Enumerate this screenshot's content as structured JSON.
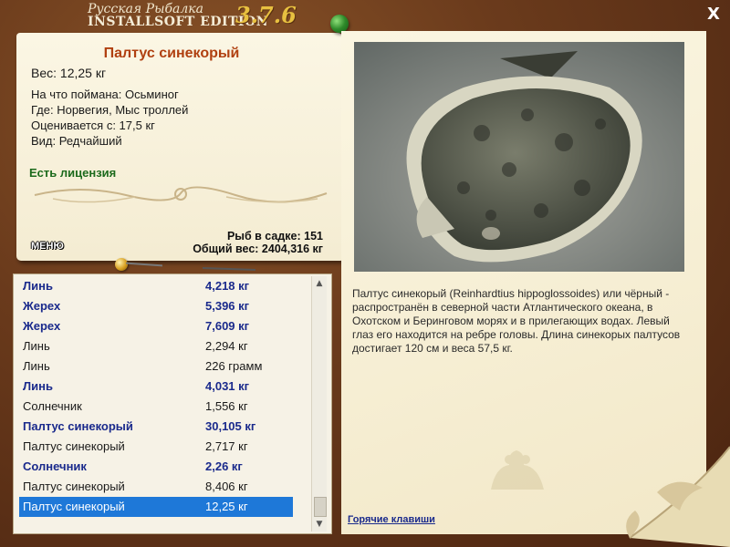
{
  "window": {
    "title_top": "Русская Рыбалка",
    "title_main": "INSTALLSOFT EDITION",
    "version": "3.7.6",
    "close_label": "X"
  },
  "fish": {
    "name": "Палтус синекорый",
    "weight": "Вес: 12,25 кг",
    "bait": "На что поймана: Осьминог",
    "place": "Где: Норвегия, Мыс троллей",
    "value": "Оценивается с: 17,5 кг",
    "rarity": "Вид: Редчайший",
    "license": "Есть лицензия"
  },
  "stats": {
    "count": "Рыб в садке: 151",
    "total": "Общий вес: 2404,316 кг"
  },
  "menu_label": "МЕНЮ",
  "catch_list": [
    {
      "name": "Линь",
      "weight": "4,218 кг",
      "bold": true
    },
    {
      "name": "Жерех",
      "weight": "5,396 кг",
      "bold": true
    },
    {
      "name": "Жерех",
      "weight": "7,609 кг",
      "bold": true
    },
    {
      "name": "Линь",
      "weight": "2,294 кг",
      "bold": false
    },
    {
      "name": "Линь",
      "weight": "226 грамм",
      "bold": false
    },
    {
      "name": "Линь",
      "weight": "4,031 кг",
      "bold": true
    },
    {
      "name": "Солнечник",
      "weight": "1,556 кг",
      "bold": false
    },
    {
      "name": "Палтус синекорый",
      "weight": "30,105 кг",
      "bold": true
    },
    {
      "name": "Палтус синекорый",
      "weight": "2,717 кг",
      "bold": false
    },
    {
      "name": "Солнечник",
      "weight": "2,26 кг",
      "bold": true
    },
    {
      "name": "Палтус синекорый",
      "weight": "8,406 кг",
      "bold": false
    },
    {
      "name": "Палтус синекорый",
      "weight": "12,25 кг",
      "bold": false,
      "selected": true
    }
  ],
  "description": "Палтус синекорый (Reinhardtius hippoglossoides) или чёрный - распространён в северной части Атлантического океана, в Охотском и Беринговом морях и в прилегающих водах. Левый глаз его находится на ребре головы. Длина синекорых палтусов достигает 120 см и веса 57,5 кг.",
  "hotkeys_label": "Горячие клавиши",
  "colors": {
    "frame": "#6b3b1c",
    "paper": "#f8f1da",
    "fish_name": "#b04010",
    "license": "#1c6a1c",
    "bold_row": "#1a2a8c",
    "selection": "#1e78d8"
  }
}
